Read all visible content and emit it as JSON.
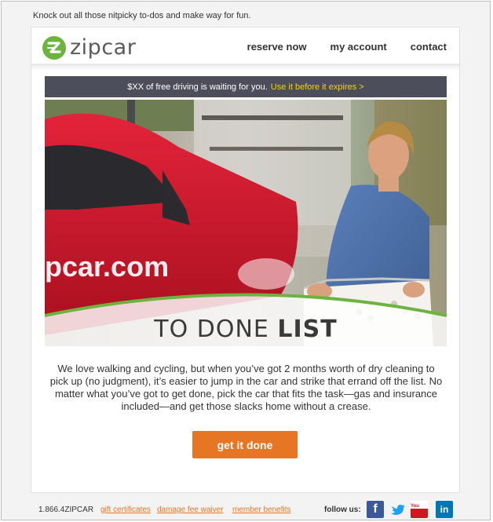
{
  "preheader": "Knock out all those nitpicky to-dos and make way for fun.",
  "logo": {
    "brand": "zipcar",
    "mark_letter": "Z"
  },
  "nav": {
    "items": [
      "reserve now",
      "my account",
      "contact"
    ]
  },
  "promo": {
    "text": "$XX of free driving is waiting for you.",
    "link": "Use it before it expires  >"
  },
  "hero": {
    "car_text": "pcar.com",
    "headline_light": "TO DONE ",
    "headline_bold": "LIST"
  },
  "body": "We love walking and cycling, but when you’ve got 2 months worth of dry cleaning to pick up (no judgment), it’s easier to jump in the car and strike that errand off the list. No matter what you’ve got to get done, pick the car that fits the task—gas and insurance included—and get those slacks home without a crease.",
  "cta": {
    "label": "get it done"
  },
  "footer": {
    "phone": "1.866.4ZIPCAR",
    "links": [
      "gift certificates",
      "damage fee waiver",
      "member benefits"
    ],
    "follow": "follow us:",
    "social_icons": [
      "facebook-icon",
      "twitter-icon",
      "youtube-icon",
      "linkedin-icon"
    ],
    "social_labels": {
      "facebook": "f",
      "linkedin": "in",
      "youtube": "You Tube"
    }
  },
  "colors": {
    "brand_green": "#6cb33f",
    "cta_orange": "#e77624",
    "promo_bg": "#4c4f5b",
    "promo_link": "#f6d300"
  }
}
